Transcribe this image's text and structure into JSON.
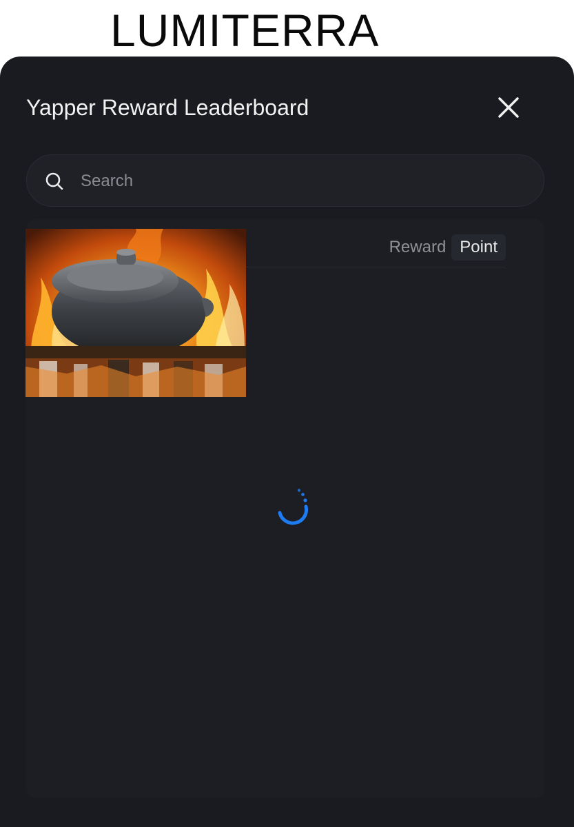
{
  "brand": {
    "title": "LUMITERRA"
  },
  "modal": {
    "title": "Yapper Reward Leaderboard",
    "close_icon": "close-icon"
  },
  "search": {
    "icon": "search-icon",
    "placeholder": "Search",
    "value": ""
  },
  "leaderboard": {
    "toggle": {
      "options": [
        "Reward",
        "Point"
      ],
      "selected": "Point"
    },
    "status": "loading"
  },
  "colors": {
    "modal_bg": "#191b20",
    "panel_bg": "#1c1e23",
    "spinner_accent": "#1e7bf0",
    "title_text": "#f2f2f2"
  }
}
